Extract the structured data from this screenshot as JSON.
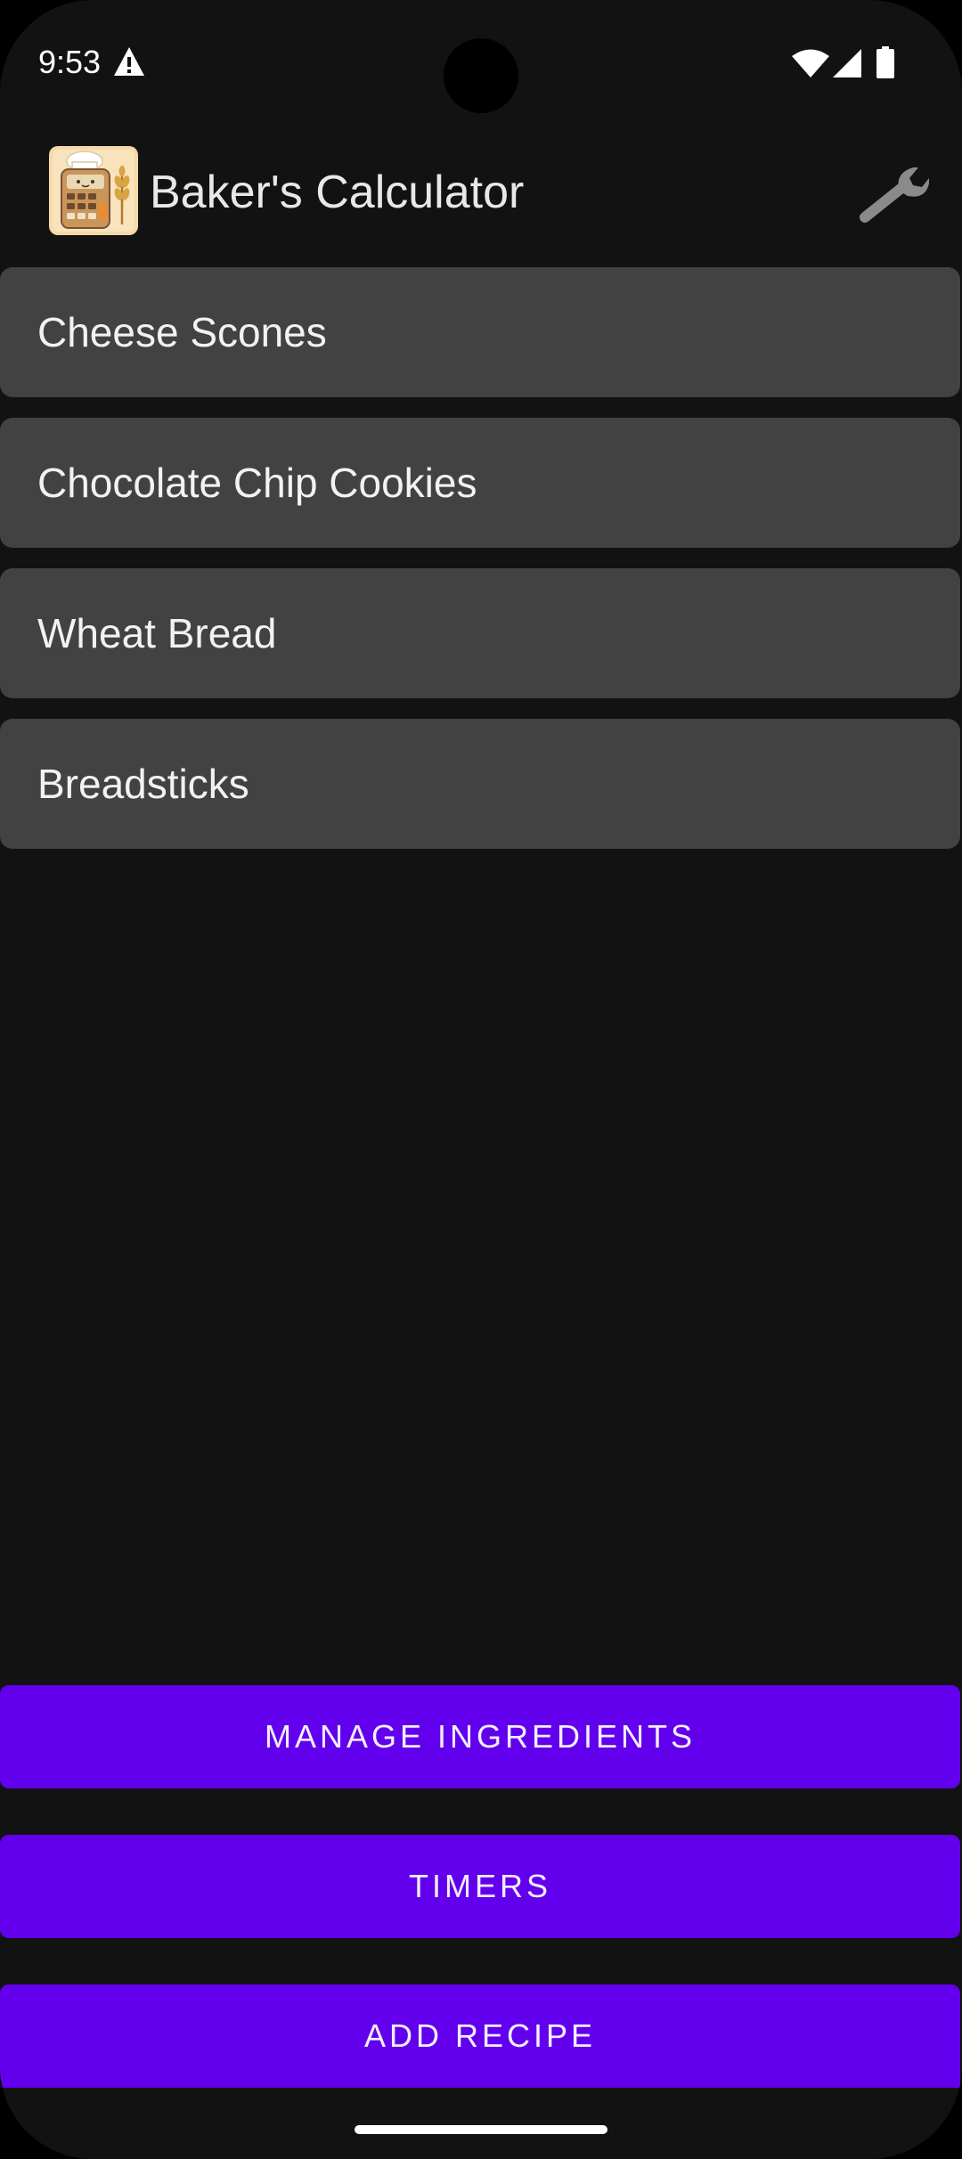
{
  "status_bar": {
    "time": "9:53",
    "icons": [
      "warning-icon",
      "wifi-icon",
      "signal-icon",
      "battery-icon"
    ]
  },
  "app_bar": {
    "title": "Baker's Calculator",
    "logo_icon": "calculator-chef-logo",
    "settings_icon": "wrench-icon"
  },
  "recipes": [
    {
      "name": "Cheese Scones"
    },
    {
      "name": "Chocolate Chip Cookies"
    },
    {
      "name": "Wheat Bread"
    },
    {
      "name": "Breadsticks"
    }
  ],
  "actions": {
    "manage_ingredients": "MANAGE INGREDIENTS",
    "timers": "TIMERS",
    "add_recipe": "ADD RECIPE"
  },
  "colors": {
    "background": "#121212",
    "list_item": "#424242",
    "accent": "#6200ee"
  }
}
